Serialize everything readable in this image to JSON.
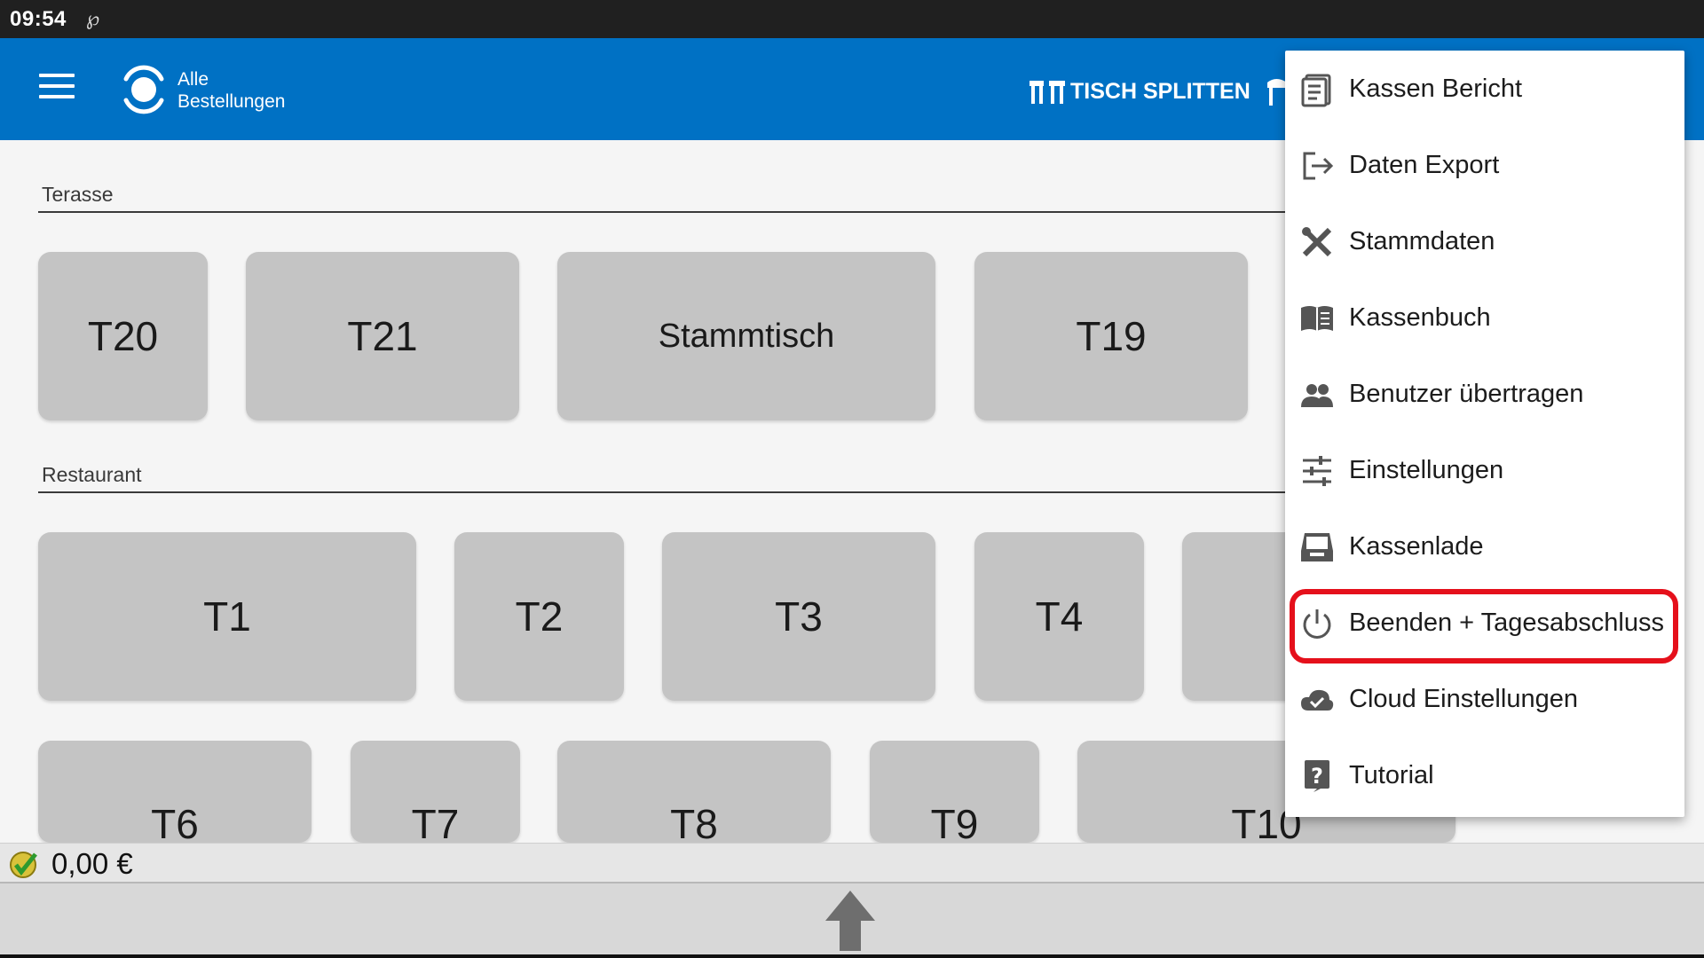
{
  "status_bar": {
    "time": "09:54",
    "sync_glyph": "℘"
  },
  "app_bar": {
    "title_line1": "Alle",
    "title_line2": "Bestellungen",
    "split_label": "TISCH SPLITTEN",
    "color": "#0071c4"
  },
  "sections": {
    "terrace": {
      "label": "Terasse"
    },
    "restaurant": {
      "label": "Restaurant"
    }
  },
  "tables": {
    "terrace": [
      "T20",
      "T21",
      "Stammtisch",
      "T19"
    ],
    "restaurant_row1": [
      "T1",
      "T2",
      "T3",
      "T4"
    ],
    "restaurant_row2": [
      "T6",
      "T7",
      "T8",
      "T9",
      "T10"
    ]
  },
  "menu": {
    "items": [
      {
        "label": "Kassen Bericht",
        "icon": "report-icon"
      },
      {
        "label": "Daten Export",
        "icon": "export-icon"
      },
      {
        "label": "Stammdaten",
        "icon": "tools-icon"
      },
      {
        "label": "Kassenbuch",
        "icon": "book-icon"
      },
      {
        "label": "Benutzer übertragen",
        "icon": "users-icon"
      },
      {
        "label": "Einstellungen",
        "icon": "sliders-icon"
      },
      {
        "label": "Kassenlade",
        "icon": "drawer-icon"
      },
      {
        "label": "Beenden + Tagesabschluss",
        "icon": "power-icon"
      },
      {
        "label": "Cloud Einstellungen",
        "icon": "cloud-check-icon"
      },
      {
        "label": "Tutorial",
        "icon": "help-icon"
      }
    ],
    "highlight_color": "#e5101b"
  },
  "footer": {
    "amount": "0,00 €"
  }
}
